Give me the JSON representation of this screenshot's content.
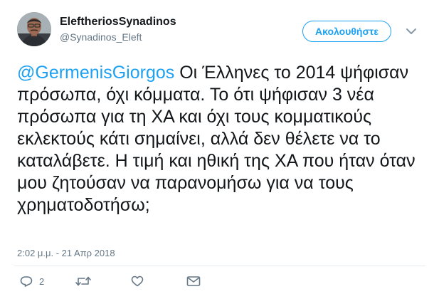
{
  "user": {
    "display_name": "EleftheriosSynadinos",
    "handle": "@Synadinos_Eleft"
  },
  "follow_button": {
    "label": "Ακολουθήστε"
  },
  "tweet": {
    "mention": "@GermenisGiorgos",
    "text": " Οι Έλληνες το 2014 ψήφισαν πρόσωπα, όχι κόμματα. Το ότι ψήφισαν 3 νέα πρόσωπα για τη ΧΑ και όχι τους κομματικούς εκλεκτούς κάτι σημαίνει, αλλά δεν θέλετε να το καταλάβετε. Η τιμή και ηθική της ΧΑ που ήταν όταν μου ζητούσαν να παρανομήσω για να τους χρηματοδοτήσω;",
    "timestamp": "2:02 μ.μ. - 21 Απρ 2018"
  },
  "actions": {
    "reply_count": "2"
  },
  "icons": {
    "caret": "chevron-down-icon",
    "reply": "reply-icon",
    "retweet": "retweet-icon",
    "like": "heart-icon",
    "message": "envelope-icon"
  },
  "colors": {
    "accent": "#1da1f2",
    "text": "#14171a",
    "secondary": "#657786",
    "divider": "#e6ecf0"
  }
}
